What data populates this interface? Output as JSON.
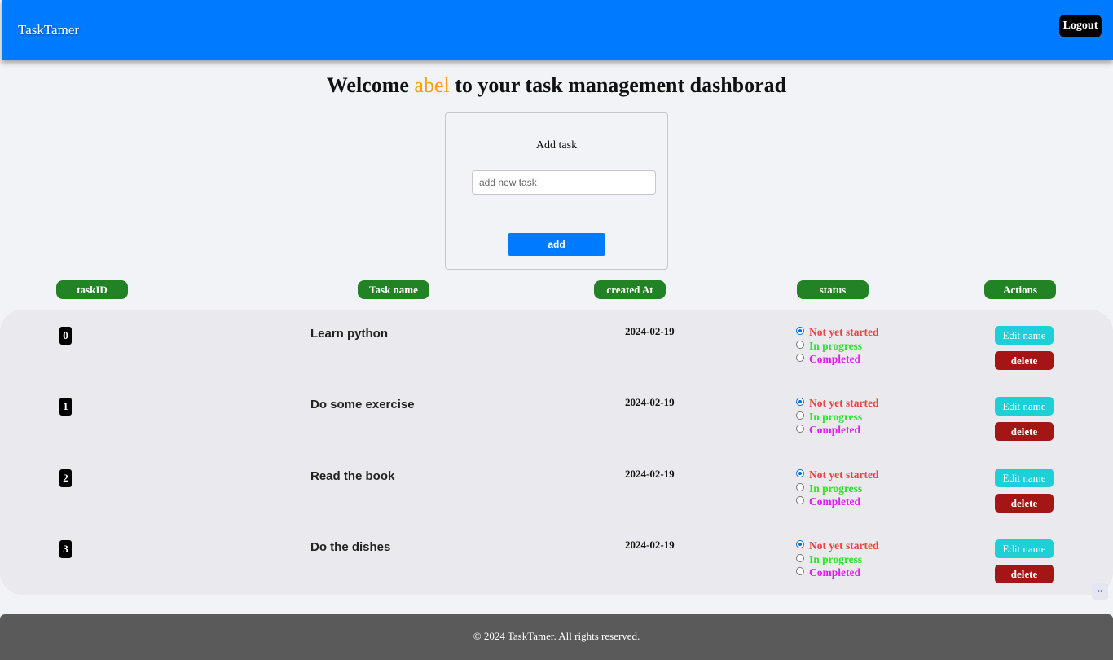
{
  "navbar": {
    "brand": "TaskTamer",
    "logout_label": "Logout"
  },
  "welcome": {
    "prefix": "Welcome",
    "username": "abel",
    "suffix": "to your task management dashborad"
  },
  "add_task": {
    "title": "Add task",
    "input_placeholder": "add new task",
    "input_value": "",
    "button_label": "add"
  },
  "columns": [
    "taskID",
    "Task name",
    "created At",
    "status",
    "Actions"
  ],
  "status_options": {
    "not_started": "Not yet started",
    "in_progress": "In progress",
    "completed": "Completed"
  },
  "actions": {
    "edit_label": "Edit name",
    "delete_label": "delete"
  },
  "tasks": [
    {
      "id": "0",
      "name": "Learn python",
      "created_at": "2024-02-19",
      "status": "not_started"
    },
    {
      "id": "1",
      "name": "Do some exercise",
      "created_at": "2024-02-19",
      "status": "not_started"
    },
    {
      "id": "2",
      "name": "Read the book",
      "created_at": "2024-02-19",
      "status": "not_started"
    },
    {
      "id": "3",
      "name": "Do the dishes",
      "created_at": "2024-02-19",
      "status": "not_started"
    }
  ],
  "footer": {
    "text": "© 2024 TaskTamer. All rights reserved."
  },
  "colors": {
    "primary": "#007bff",
    "header_green": "#218323",
    "edit": "#1dcfd6",
    "delete": "#a51515",
    "username": "#ff9c00",
    "not_started": "#e84545",
    "in_progress": "#2ee62e",
    "completed": "#e01ff0"
  }
}
